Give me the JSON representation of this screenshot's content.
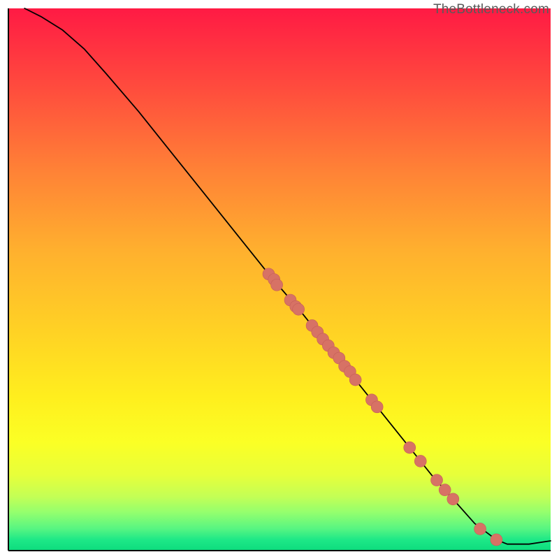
{
  "watermark": "TheBottleneck.com",
  "colors": {
    "curve": "#000000",
    "point_fill": "#d77265",
    "point_stroke": "#c55f57",
    "gradient_top": "#ff1a44",
    "gradient_mid": "#ffef1e",
    "gradient_bottom": "#0ddc7e",
    "axis": "#000000"
  },
  "chart_data": {
    "type": "line",
    "title": "",
    "xlabel": "",
    "ylabel": "",
    "xlim": [
      0,
      100
    ],
    "ylim": [
      0,
      100
    ],
    "grid": false,
    "legend": false,
    "series": [
      {
        "name": "curve",
        "x": [
          3,
          6,
          10,
          14,
          18,
          24,
          30,
          36,
          42,
          48,
          54,
          58,
          62,
          66,
          70,
          74,
          78,
          82,
          86,
          88,
          90,
          92,
          96,
          100
        ],
        "y": [
          100,
          98.5,
          96,
          92.5,
          88,
          81,
          73.5,
          66,
          58.5,
          51,
          44,
          39,
          34,
          29,
          24,
          19,
          14,
          9.5,
          5,
          3.5,
          2,
          1.2,
          1.2,
          1.8
        ]
      }
    ],
    "points": [
      {
        "x": 48,
        "y": 51
      },
      {
        "x": 49,
        "y": 50
      },
      {
        "x": 49.5,
        "y": 49
      },
      {
        "x": 52,
        "y": 46.2
      },
      {
        "x": 53,
        "y": 45
      },
      {
        "x": 53.5,
        "y": 44.5
      },
      {
        "x": 56,
        "y": 41.5
      },
      {
        "x": 57,
        "y": 40.3
      },
      {
        "x": 58,
        "y": 39
      },
      {
        "x": 59,
        "y": 37.8
      },
      {
        "x": 60,
        "y": 36.5
      },
      {
        "x": 61,
        "y": 35.5
      },
      {
        "x": 62,
        "y": 34
      },
      {
        "x": 63,
        "y": 33
      },
      {
        "x": 64,
        "y": 31.5
      },
      {
        "x": 67,
        "y": 27.8
      },
      {
        "x": 68,
        "y": 26.5
      },
      {
        "x": 74,
        "y": 19
      },
      {
        "x": 76,
        "y": 16.5
      },
      {
        "x": 79,
        "y": 13
      },
      {
        "x": 80.5,
        "y": 11.2
      },
      {
        "x": 82,
        "y": 9.5
      },
      {
        "x": 87,
        "y": 4
      },
      {
        "x": 90,
        "y": 2
      }
    ]
  }
}
